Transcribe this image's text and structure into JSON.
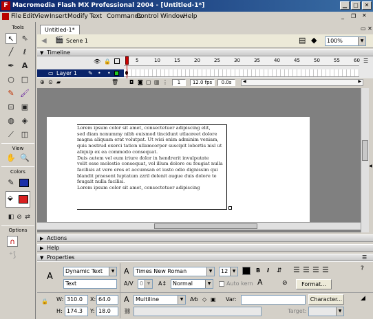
{
  "window": {
    "title": "Macromedia Flash MX Professional 2004 - [Untitled-1*]",
    "app_icon": "F"
  },
  "menubar": [
    "File",
    "Edit",
    "View",
    "Insert",
    "Modify",
    "Text",
    "Commands",
    "Control",
    "Window",
    "Help"
  ],
  "tools": {
    "header": "Tools",
    "view_header": "View",
    "colors_header": "Colors",
    "options_header": "Options"
  },
  "document": {
    "tab": "Untitled-1*",
    "scene": "Scene 1",
    "zoom": "100%"
  },
  "timeline": {
    "header": "Timeline",
    "layer_name": "Layer 1",
    "frame_numbers": [
      "5",
      "10",
      "15",
      "20",
      "25",
      "30",
      "35",
      "40",
      "45",
      "50",
      "55",
      "60"
    ],
    "current_frame": "1",
    "fps": "12.0 fps",
    "elapsed": "0.0s"
  },
  "stage": {
    "paragraphs": [
      "Lorem ipsum color sit amet, consectetuer adipiscing elit,",
      " sed diam nonummy nibh euismod tincidunt utlaoreet dolore",
      "magna aliquam erat volutpat. Ut wisi enim adminim veniam,",
      "quis nostrud exerci tation ullamcorper  suscipit lobortis nisl ut",
      "aliquip ex ea commodo consequat.",
      "Duis autem vel eum iriure dolor in hendrerit invulputate",
      "  velit esse molestie consequat, vel illum dolore eu feugiat nulla",
      "facilisis at  vero eros et accumsan et iusto odio dignissim qui",
      "blandit praesent luptatum  zzril delenit augue duis dolore te",
      "feugait nulla facilisi.",
      "Lorem ipsum color sit amet, consectetuer adipiscing"
    ]
  },
  "panels": {
    "actions": "Actions",
    "help": "Help",
    "properties": "Properties"
  },
  "properties": {
    "text_type": "Dynamic Text",
    "instance_name": "Text",
    "font": "Times New Roman",
    "font_size": "12",
    "rendering": "Normal",
    "auto_kern": "Auto kern",
    "format_button": "Format...",
    "line_type": "Multiline",
    "var_label": "Var:",
    "character_button": "Character...",
    "target_label": "Target:",
    "w_label": "W:",
    "w_value": "310.0",
    "x_label": "X:",
    "x_value": "64.0",
    "h_label": "H:",
    "h_value": "174.3",
    "y_label": "Y:",
    "y_value": "18.0",
    "tracking_value": "0"
  },
  "colors": {
    "title_start": "#0a246a",
    "title_end": "#3a6ea5",
    "stroke": "#1c2fa8",
    "fill": "#d82020",
    "playhead": "#cc0000"
  }
}
